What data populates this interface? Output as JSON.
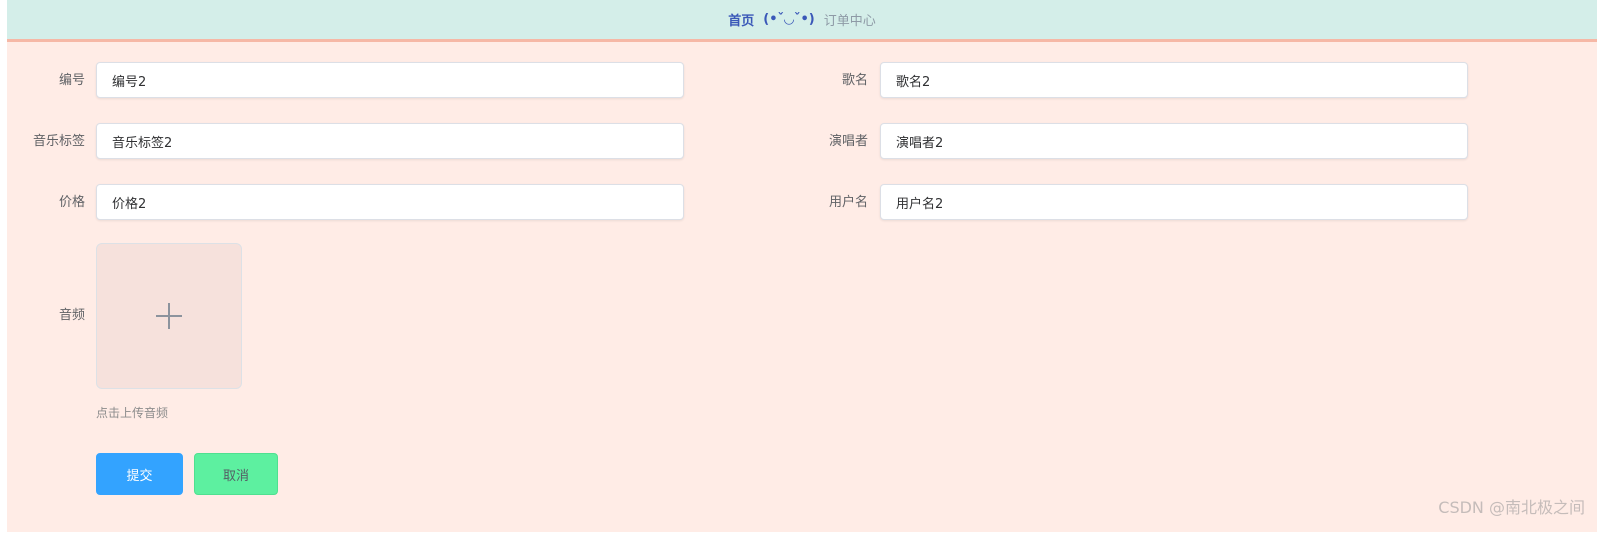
{
  "breadcrumb": {
    "home": "首页",
    "separator": "(•ˇ◡ˇ•)",
    "current": "订单中心"
  },
  "form": {
    "fields": {
      "number": {
        "label": "编号",
        "value": "编号2"
      },
      "song_name": {
        "label": "歌名",
        "value": "歌名2"
      },
      "music_tag": {
        "label": "音乐标签",
        "value": "音乐标签2"
      },
      "singer": {
        "label": "演唱者",
        "value": "演唱者2"
      },
      "price": {
        "label": "价格",
        "value": "价格2"
      },
      "username": {
        "label": "用户名",
        "value": "用户名2"
      }
    },
    "audio": {
      "label": "音频",
      "upload_tip": "点击上传音频",
      "icon": "plus-icon"
    },
    "buttons": {
      "submit": "提交",
      "cancel": "取消"
    }
  },
  "watermark": "CSDN @南北极之间",
  "colors": {
    "topbar_bg": "#d4eee9",
    "form_bg": "#ffece6",
    "submit_bg": "#33a3ff",
    "cancel_bg": "#5df0a0",
    "accent_border": "#f6b8a6"
  }
}
